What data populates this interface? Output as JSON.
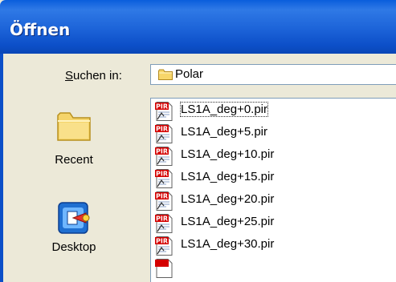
{
  "window": {
    "title": "Öffnen"
  },
  "lookin": {
    "label_prefix": "S",
    "label_rest": "uchen in:",
    "value": "Polar",
    "folder_icon": "folder-icon"
  },
  "places": [
    {
      "label": "Recent",
      "icon": "recent-folder-icon"
    },
    {
      "label": "Desktop",
      "icon": "desktop-icon"
    }
  ],
  "files": [
    {
      "name": "LS1A_deg+0.pir",
      "icon_text": "PIR"
    },
    {
      "name": "LS1A_deg+5.pir",
      "icon_text": "PIR"
    },
    {
      "name": "LS1A_deg+10.pir",
      "icon_text": "PIR"
    },
    {
      "name": "LS1A_deg+15.pir",
      "icon_text": "PIR"
    },
    {
      "name": "LS1A_deg+20.pir",
      "icon_text": "PIR"
    },
    {
      "name": "LS1A_deg+25.pir",
      "icon_text": "PIR"
    },
    {
      "name": "LS1A_deg+30.pir",
      "icon_text": "PIR"
    }
  ],
  "colors": {
    "titlebar": "#0c4fc8",
    "dialog": "#ece9d8",
    "pir_red": "#d40000"
  }
}
